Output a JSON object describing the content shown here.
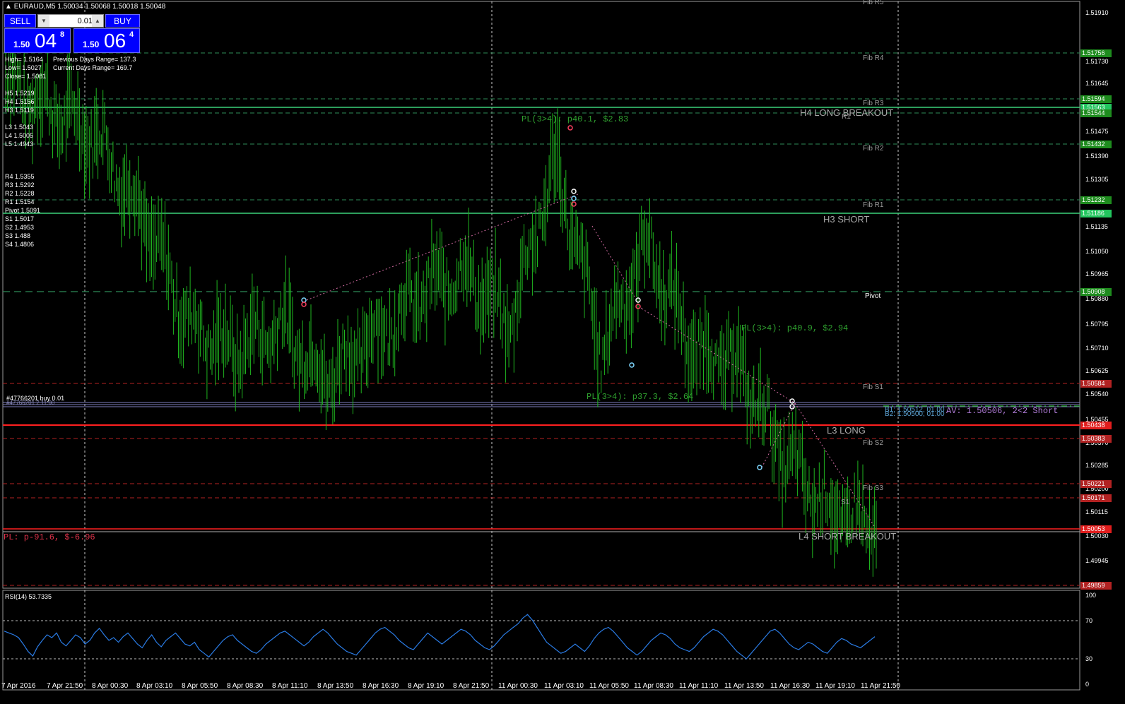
{
  "header": {
    "symbol_info": "EURAUD,M5  1.50034 1.50068 1.50018 1.50048"
  },
  "trade_panel": {
    "sell_label": "SELL",
    "buy_label": "BUY",
    "lot_value": "0.01",
    "bid": {
      "prefix": "1.50",
      "big": "04",
      "sup": "8"
    },
    "ask": {
      "prefix": "1.50",
      "big": "06",
      "sup": "4"
    }
  },
  "info": {
    "high": "High= 1.5164",
    "low": "Low= 1.5027",
    "close": "Close= 1.5081",
    "prev_range": "Previous Days Range= 137.3",
    "curr_range": "Current Days Range= 169.7",
    "h_levels": [
      "H5 1.5219",
      "H4 1.5156",
      "H3 1.5119",
      "",
      "L3 1.5043",
      "L4 1.5005",
      "L5 1.4943"
    ],
    "pivots": [
      "R4 1.5355",
      "R3 1.5292",
      "R2 1.5228",
      "R1 1.5154",
      "Pivot 1.5091",
      "S1 1.5017",
      "S2 1.4953",
      "S3 1.488",
      "S4 1.4806"
    ]
  },
  "y_axis": {
    "ticks": [
      "1.51910",
      "1.51730",
      "1.51645",
      "1.51475",
      "1.51390",
      "1.51305",
      "1.51135",
      "1.51050",
      "1.50965",
      "1.50880",
      "1.50795",
      "1.50710",
      "1.50625",
      "1.50540",
      "1.50455",
      "1.50370",
      "1.50285",
      "1.50200",
      "1.50115",
      "1.50030",
      "1.49945"
    ]
  },
  "price_tags": [
    {
      "text": "1.51756",
      "color": "#1e8c1e"
    },
    {
      "text": "1.51594",
      "color": "#1e8c1e"
    },
    {
      "text": "1.51563",
      "color": "#22c55e"
    },
    {
      "text": "1.51544",
      "color": "#1e8c1e"
    },
    {
      "text": "1.51432",
      "color": "#1e8c1e"
    },
    {
      "text": "1.51232",
      "color": "#1e8c1e"
    },
    {
      "text": "1.51186",
      "color": "#22c55e"
    },
    {
      "text": "1.50908",
      "color": "#1e8c1e"
    },
    {
      "text": "1.50584",
      "color": "#b22222"
    },
    {
      "text": "1.50438",
      "color": "#e11d1d"
    },
    {
      "text": "1.50383",
      "color": "#b22222"
    },
    {
      "text": "1.50221",
      "color": "#b22222"
    },
    {
      "text": "1.50171",
      "color": "#b22222"
    },
    {
      "text": "1.50053",
      "color": "#e11d1d"
    },
    {
      "text": "1.49859",
      "color": "#b22222"
    }
  ],
  "fib_labels": [
    "Fib R5",
    "Fib R4",
    "Fib R3",
    "Fib R2",
    "Fib R1",
    "Pivot",
    "Fib S1",
    "Fib S2",
    "Fib S3"
  ],
  "level_labels": {
    "h4": "H4 LONG BREAKOUT",
    "r1": "R1",
    "h3": "H3 SHORT",
    "l3": "L3 LONG",
    "s1": "S1",
    "l4": "L4 SHORT BREAKOUT"
  },
  "pl_labels": [
    "PL(3>4): p40.1, $2.83",
    "PL(3>4): p40.9, $2.94",
    "PL(3>4): p37.3, $2.64"
  ],
  "order": {
    "order_label": "#47766201 buy 0.01",
    "order_sub": "#47766201 2.11.00",
    "b2": "B2: 1.50500, 01.00",
    "b1": "B1: 1.50512, 01.00",
    "av": "AV: 1.50506, 2<2 Short",
    "pl_total": "PL: p-91.6, $-6.96"
  },
  "rsi": {
    "label": "RSI(14) 53.7335",
    "ticks": [
      "100",
      "70",
      "30",
      "0"
    ],
    "values": [
      62,
      60,
      58,
      55,
      48,
      40,
      35,
      45,
      52,
      58,
      55,
      60,
      50,
      46,
      52,
      58,
      55,
      48,
      52,
      60,
      65,
      58,
      52,
      55,
      50,
      56,
      60,
      54,
      48,
      44,
      52,
      58,
      50,
      45,
      52,
      56,
      60,
      54,
      48,
      46,
      50,
      42,
      38,
      34,
      40,
      46,
      52,
      56,
      58,
      52,
      48,
      44,
      40,
      38,
      42,
      48,
      52,
      56,
      60,
      62,
      58,
      54,
      50,
      46,
      50,
      56,
      60,
      64,
      60,
      54,
      48,
      44,
      40,
      38,
      36,
      42,
      48,
      54,
      60,
      64,
      66,
      62,
      58,
      52,
      48,
      44,
      42,
      48,
      54,
      60,
      56,
      52,
      48,
      52,
      56,
      60,
      64,
      62,
      58,
      52,
      48,
      44,
      42,
      46,
      52,
      58,
      62,
      66,
      70,
      76,
      80,
      74,
      66,
      58,
      50,
      46,
      42,
      38,
      40,
      44,
      48,
      44,
      40,
      46,
      54,
      60,
      64,
      66,
      62,
      56,
      50,
      44,
      40,
      36,
      40,
      46,
      52,
      56,
      60,
      58,
      54,
      48,
      44,
      42,
      40,
      44,
      50,
      56,
      60,
      64,
      62,
      58,
      52,
      46,
      40,
      36,
      32,
      38,
      44,
      50,
      56,
      62,
      64,
      60,
      54,
      48,
      44,
      42,
      46,
      50,
      48,
      44,
      40,
      38,
      44,
      50,
      54,
      52,
      48,
      46,
      44,
      48,
      52,
      56
    ]
  },
  "x_axis": {
    "ticks": [
      "7 Apr 2016",
      "7 Apr 21:50",
      "8 Apr 00:30",
      "8 Apr 03:10",
      "8 Apr 05:50",
      "8 Apr 08:30",
      "8 Apr 11:10",
      "8 Apr 13:50",
      "8 Apr 16:30",
      "8 Apr 19:10",
      "8 Apr 21:50",
      "11 Apr 00:30",
      "11 Apr 03:10",
      "11 Apr 05:50",
      "11 Apr 08:30",
      "11 Apr 11:10",
      "11 Apr 13:50",
      "11 Apr 16:30",
      "11 Apr 19:10",
      "11 Apr 21:50"
    ]
  },
  "chart_data": {
    "type": "line",
    "title": "EURAUD,M5",
    "x": [
      "7 Apr 2016",
      "7 Apr 21:50",
      "8 Apr 00:30",
      "8 Apr 03:10",
      "8 Apr 05:50",
      "8 Apr 08:30",
      "8 Apr 11:10",
      "8 Apr 13:50",
      "8 Apr 16:30",
      "8 Apr 19:10",
      "8 Apr 21:50",
      "11 Apr 00:30",
      "11 Apr 03:10",
      "11 Apr 05:50",
      "11 Apr 08:30",
      "11 Apr 11:10",
      "11 Apr 13:50",
      "11 Apr 16:30",
      "11 Apr 19:10",
      "11 Apr 21:50"
    ],
    "series": [
      {
        "values": [
          1.517,
          1.516,
          1.515,
          1.512,
          1.508,
          1.507,
          1.508,
          1.506,
          1.5075,
          1.509,
          1.51,
          1.508,
          1.514,
          1.507,
          1.511,
          1.507,
          1.5065,
          1.503,
          1.501,
          1.5005
        ]
      }
    ],
    "ylim": [
      1.4985,
      1.5195
    ]
  }
}
